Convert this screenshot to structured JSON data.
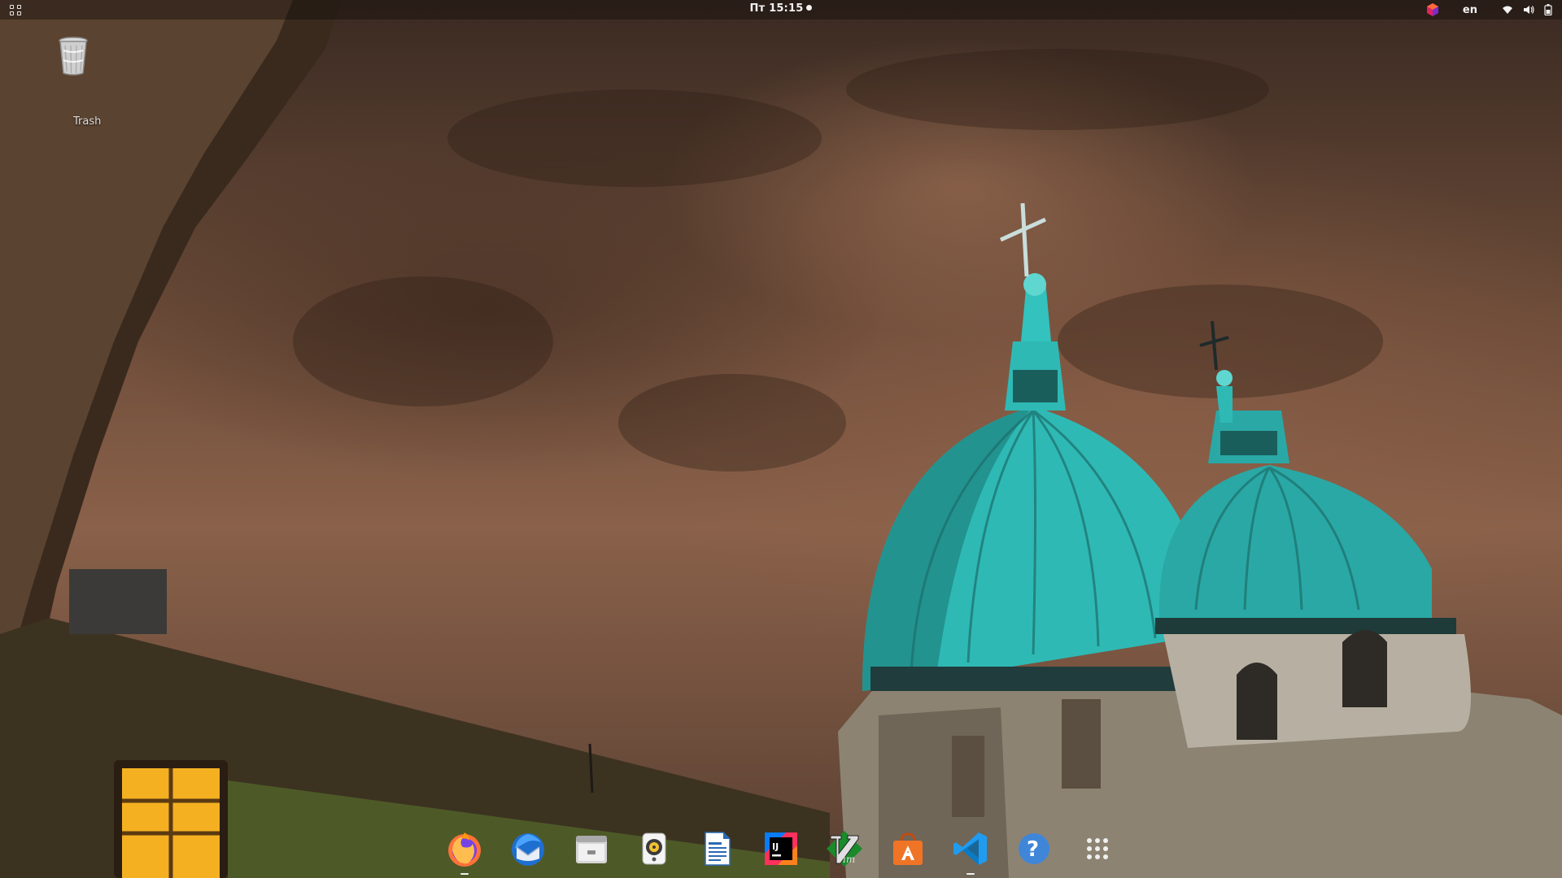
{
  "topbar": {
    "clock": "Пт 15:15",
    "language": "en",
    "icons": [
      "activities-icon",
      "app-cube-icon",
      "wifi-icon",
      "volume-icon",
      "battery-icon"
    ]
  },
  "desktop": {
    "trash": {
      "label": "Trash",
      "icon": "trash-icon"
    }
  },
  "dock": {
    "items": [
      {
        "name": "firefox",
        "icon": "firefox-icon",
        "running": true
      },
      {
        "name": "thunderbird",
        "icon": "thunderbird-icon",
        "running": false
      },
      {
        "name": "files",
        "icon": "files-icon",
        "running": false
      },
      {
        "name": "rhythmbox",
        "icon": "rhythmbox-icon",
        "running": false
      },
      {
        "name": "libreoffice-writer",
        "icon": "writer-icon",
        "running": false
      },
      {
        "name": "intellij-idea",
        "icon": "intellij-icon",
        "running": false
      },
      {
        "name": "vim",
        "icon": "vim-icon",
        "running": false
      },
      {
        "name": "software-center",
        "icon": "software-center-icon",
        "running": false
      },
      {
        "name": "vscode",
        "icon": "vscode-icon",
        "running": true
      },
      {
        "name": "help",
        "icon": "help-icon",
        "running": false
      },
      {
        "name": "show-applications",
        "icon": "app-grid-icon",
        "running": false
      }
    ]
  },
  "colors": {
    "sky": "#7a5641",
    "dome": "#2fb9b5",
    "topbar_text": "#f2f2f2",
    "window_light": "#f5b021"
  },
  "wallpaper": {
    "description": "night sky over cathedral with turquoise copper domes"
  }
}
